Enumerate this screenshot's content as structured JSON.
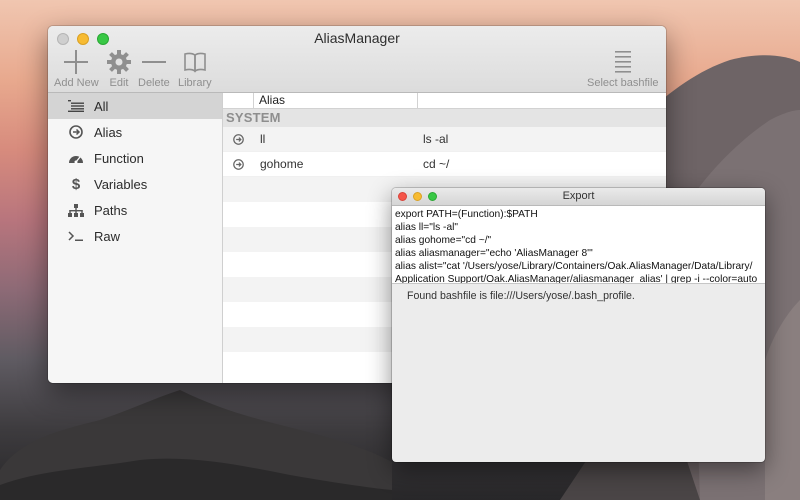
{
  "main_window": {
    "title": "AliasManager",
    "toolbar": {
      "add_new": "Add New",
      "edit": "Edit",
      "delete": "Delete",
      "library": "Library",
      "select_bashfile": "Select bashfile"
    }
  },
  "sidebar": {
    "items": [
      {
        "label": "All",
        "icon": "list-icon"
      },
      {
        "label": "Alias",
        "icon": "arrow-circle-icon"
      },
      {
        "label": "Function",
        "icon": "gauge-icon"
      },
      {
        "label": "Variables",
        "icon": "dollar-icon"
      },
      {
        "label": "Paths",
        "icon": "sitemap-icon"
      },
      {
        "label": "Raw",
        "icon": "terminal-icon"
      }
    ],
    "selected": "All"
  },
  "table": {
    "header": {
      "alias": "Alias"
    },
    "group": "SYSTEM",
    "rows": [
      {
        "alias": "ll",
        "command": "ls -al"
      },
      {
        "alias": "gohome",
        "command": "cd ~/"
      }
    ]
  },
  "export_window": {
    "title": "Export",
    "lines": [
      "export PATH=(Function):$PATH",
      "alias ll=\"ls -al\"",
      "alias gohome=\"cd ~/\"",
      "alias aliasmanager=\"echo 'AliasManager 8'\"",
      "alias alist=\"cat '/Users/yose/Library/Containers/Oak.AliasManager/Data/Library/",
      "Application Support/Oak.AliasManager/aliasmanager_alias' | grep -i --color=auto"
    ],
    "status": "Found bashfile is file:///Users/yose/.bash_profile."
  },
  "colors": {
    "close": "#f5564a",
    "minimize": "#f7bb32",
    "zoom": "#39c845",
    "selection": "#d4d4d4"
  }
}
